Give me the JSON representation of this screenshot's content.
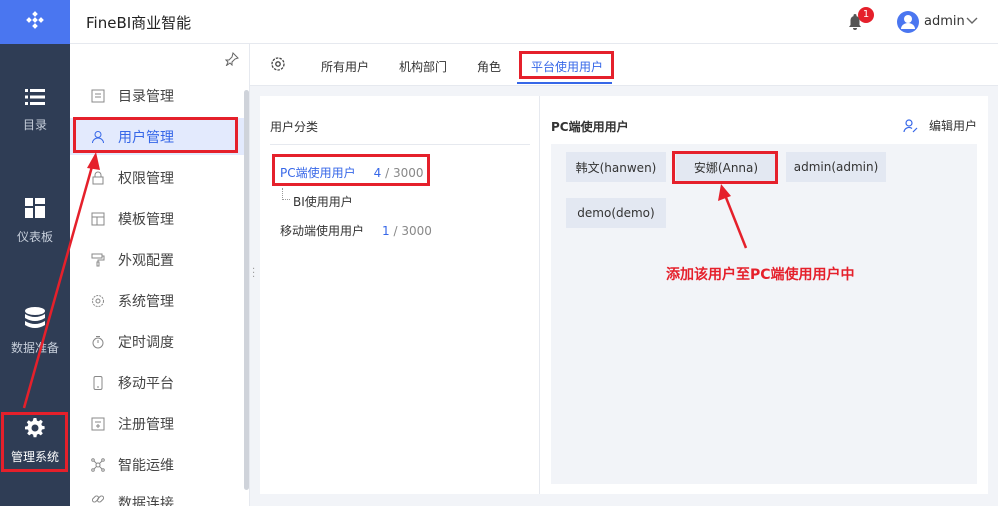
{
  "app": {
    "title": "FineBI商业智能"
  },
  "header": {
    "notification_count": "1",
    "username": "admin"
  },
  "rail": {
    "items": [
      {
        "label": "目录",
        "icon": "list-icon"
      },
      {
        "label": "仪表板",
        "icon": "dashboard-icon"
      },
      {
        "label": "数据准备",
        "icon": "database-icon"
      },
      {
        "label": "管理系统",
        "icon": "gear-icon",
        "active": true
      }
    ]
  },
  "sidebar": {
    "items": [
      {
        "label": "目录管理",
        "icon": "catalog-icon"
      },
      {
        "label": "用户管理",
        "icon": "user-icon",
        "active": true
      },
      {
        "label": "权限管理",
        "icon": "lock-icon"
      },
      {
        "label": "模板管理",
        "icon": "template-icon"
      },
      {
        "label": "外观配置",
        "icon": "paint-roller-icon"
      },
      {
        "label": "系统管理",
        "icon": "settings-icon"
      },
      {
        "label": "定时调度",
        "icon": "timer-icon"
      },
      {
        "label": "移动平台",
        "icon": "mobile-icon"
      },
      {
        "label": "注册管理",
        "icon": "register-icon"
      },
      {
        "label": "智能运维",
        "icon": "network-icon"
      },
      {
        "label": "数据连接",
        "icon": "link-icon"
      }
    ]
  },
  "tabs": {
    "items": [
      {
        "label": "所有用户"
      },
      {
        "label": "机构部门"
      },
      {
        "label": "角色"
      },
      {
        "label": "平台使用用户",
        "active": true
      }
    ]
  },
  "user_categories": {
    "title": "用户分类",
    "items": [
      {
        "name": "PC端使用用户",
        "count": "4",
        "max": " / 3000",
        "active": true
      },
      {
        "name": "BI使用用户",
        "count": "",
        "max": ""
      },
      {
        "name": "移动端使用用户",
        "count": "1",
        "max": " / 3000"
      }
    ]
  },
  "pc_users": {
    "title": "PC端使用用户",
    "edit_label": "编辑用户",
    "users": [
      "韩文(hanwen)",
      "安娜(Anna)",
      "admin(admin)",
      "demo(demo)"
    ]
  },
  "annotation": {
    "text": "添加该用户至PC端使用用户中",
    "color": "#e5202b"
  },
  "colors": {
    "accent": "#3667e8",
    "rail_bg": "#2f3d55",
    "logo_bg": "#4a76f0",
    "highlight": "#e5202b"
  }
}
